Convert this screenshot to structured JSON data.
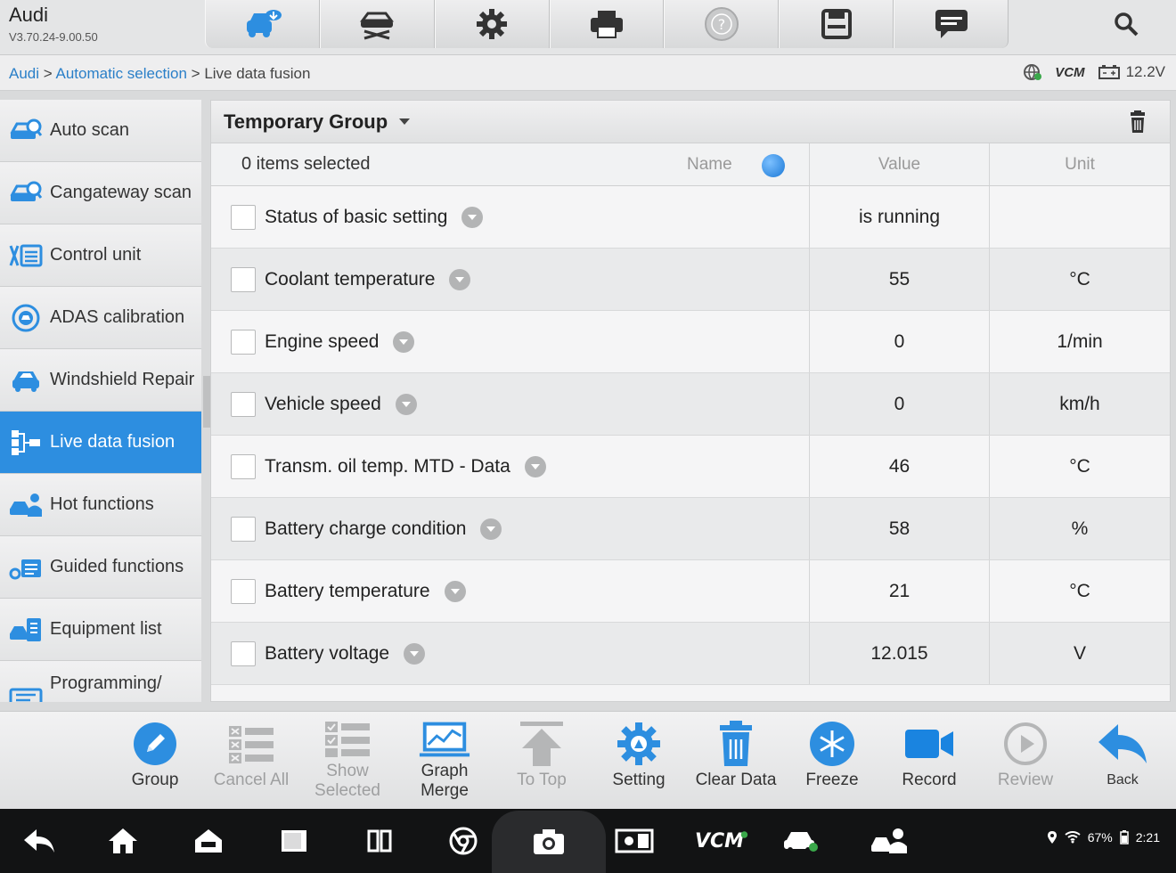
{
  "app": {
    "title": "Audi",
    "version": "V3.70.24-9.00.50"
  },
  "toolbar": {
    "icons": [
      "vehicle-download-icon",
      "car-lift-icon",
      "gear-icon",
      "printer-icon",
      "help-icon",
      "save-icon",
      "message-icon"
    ],
    "search_icon": "search-icon"
  },
  "breadcrumb": {
    "root": "Audi",
    "sep": ">",
    "level1": "Automatic selection",
    "level2": "Live data fusion"
  },
  "status": {
    "vcm": "VCM",
    "voltage": "12.2V"
  },
  "sidebar": {
    "items": [
      {
        "label": "Auto scan",
        "icon": "auto-scan-icon"
      },
      {
        "label": "Cangateway scan",
        "icon": "cangateway-scan-icon"
      },
      {
        "label": "Control unit",
        "icon": "control-unit-icon"
      },
      {
        "label": "ADAS calibration",
        "icon": "adas-icon"
      },
      {
        "label": "Windshield Repair",
        "icon": "windshield-icon"
      },
      {
        "label": "Live data fusion",
        "icon": "live-data-icon",
        "active": true
      },
      {
        "label": "Hot functions",
        "icon": "hot-functions-icon"
      },
      {
        "label": "Guided functions",
        "icon": "guided-functions-icon"
      },
      {
        "label": "Equipment list",
        "icon": "equipment-list-icon"
      },
      {
        "label": "Programming/",
        "icon": "programming-icon"
      }
    ]
  },
  "main": {
    "group_title": "Temporary Group",
    "selected_count": "0 items selected",
    "columns": {
      "name": "Name",
      "value": "Value",
      "unit": "Unit"
    },
    "rows": [
      {
        "name": "Status of basic setting",
        "value": "is running",
        "unit": ""
      },
      {
        "name": "Coolant temperature",
        "value": "55",
        "unit": "°C"
      },
      {
        "name": "Engine speed",
        "value": "0",
        "unit": "1/min"
      },
      {
        "name": "Vehicle speed",
        "value": "0",
        "unit": "km/h"
      },
      {
        "name": "Transm. oil temp. MTD - Data",
        "value": "46",
        "unit": "°C"
      },
      {
        "name": "Battery charge condition",
        "value": "58",
        "unit": "%"
      },
      {
        "name": "Battery temperature",
        "value": "21",
        "unit": "°C"
      },
      {
        "name": "Battery voltage",
        "value": "12.015",
        "unit": "V"
      }
    ]
  },
  "actions": {
    "group": "Group",
    "cancel_all": "Cancel All",
    "show_selected_1": "Show",
    "show_selected_2": "Selected",
    "graph_merge_1": "Graph",
    "graph_merge_2": "Merge",
    "to_top": "To Top",
    "setting": "Setting",
    "clear_data": "Clear Data",
    "freeze": "Freeze",
    "record": "Record",
    "review": "Review",
    "back": "Back"
  },
  "system": {
    "vcm_label": "VCM",
    "battery": "67%",
    "time": "2:21"
  },
  "colors": {
    "accent": "#2d8ee0",
    "link": "#2a7fc8",
    "record": "#1a84e0"
  }
}
